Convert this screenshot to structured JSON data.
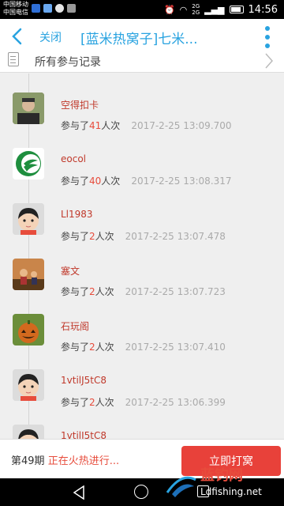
{
  "status_bar": {
    "carrier_1": "中国移动",
    "carrier_2": "中国电信",
    "net_1": "2G",
    "net_2": "2G",
    "time": "14:56"
  },
  "header": {
    "close_label": "关闭",
    "title": "[蓝米热窝子]七米..."
  },
  "records": {
    "label": "所有参与记录"
  },
  "entries": [
    {
      "name": "空得扣卡",
      "joined_prefix": "参与了",
      "count": "41",
      "joined_suffix": "人次",
      "timestamp": "2017-2-25 13:09.700",
      "avatar": "photo-man-icon"
    },
    {
      "name": "eocol",
      "joined_prefix": "参与了",
      "count": "40",
      "joined_suffix": "人次",
      "timestamp": "2017-2-25 13:08.317",
      "avatar": "green-logo-icon"
    },
    {
      "name": "Ll1983",
      "joined_prefix": "参与了",
      "count": "2",
      "joined_suffix": "人次",
      "timestamp": "2017-2-25 13:07.478",
      "avatar": "default-user-icon"
    },
    {
      "name": "塞文",
      "joined_prefix": "参与了",
      "count": "2",
      "joined_suffix": "人次",
      "timestamp": "2017-2-25 13:07.723",
      "avatar": "photo-kids-icon"
    },
    {
      "name": "石玩阁",
      "joined_prefix": "参与了",
      "count": "2",
      "joined_suffix": "人次",
      "timestamp": "2017-2-25 13:07.410",
      "avatar": "photo-pumpkin-icon"
    },
    {
      "name": "1vtilJ5tC8",
      "joined_prefix": "参与了",
      "count": "2",
      "joined_suffix": "人次",
      "timestamp": "2017-2-25 13:06.399",
      "avatar": "default-user-icon"
    },
    {
      "name": "1vtilJ5tC8",
      "joined_prefix": "",
      "count": "",
      "joined_suffix": "",
      "timestamp": "",
      "avatar": "default-user-icon"
    }
  ],
  "action_bar": {
    "period": "第49期",
    "status": "正在火热进行...",
    "buy_label": "立即打窝"
  },
  "watermark": {
    "brand": "蓝钓网",
    "url": "Ldfishing.net"
  },
  "colors": {
    "accent": "#29a3e0",
    "name_red": "#c0392b",
    "button_red": "#e8413a"
  }
}
